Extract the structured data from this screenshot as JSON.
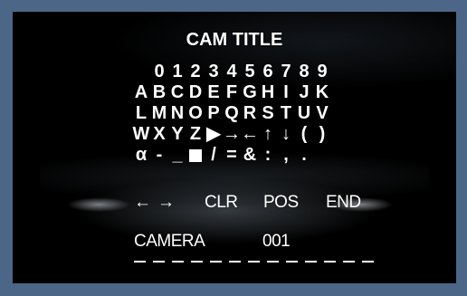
{
  "screen": {
    "title": "CAM TITLE",
    "rows": [
      [
        "",
        "0",
        "1",
        "2",
        "3",
        "4",
        "5",
        "6",
        "7",
        "8",
        "9"
      ],
      [
        "A",
        "B",
        "C",
        "D",
        "E",
        "F",
        "G",
        "H",
        "I",
        "J",
        "K"
      ],
      [
        "L",
        "M",
        "N",
        "O",
        "P",
        "Q",
        "R",
        "S",
        "T",
        "U",
        "V"
      ],
      [
        "W",
        "X",
        "Y",
        "Z",
        "▶",
        "→",
        "←",
        "↑",
        "↓",
        "(",
        ")"
      ],
      [
        "α",
        "-",
        "_",
        "■",
        "/",
        "=",
        "&",
        ":",
        ",",
        "."
      ]
    ],
    "controls": {
      "cursor_left": "←",
      "cursor_right": "→",
      "clear": "CLR",
      "position": "POS",
      "end": "END"
    },
    "name_label": "CAMERA",
    "name_value": "001",
    "dash_count": 13
  }
}
